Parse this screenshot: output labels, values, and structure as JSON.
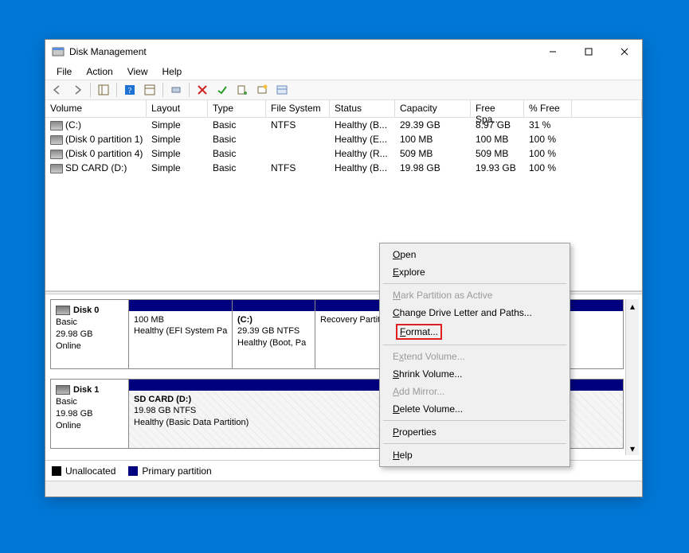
{
  "window": {
    "title": "Disk Management"
  },
  "menubar": [
    "File",
    "Action",
    "View",
    "Help"
  ],
  "columns": {
    "volume": "Volume",
    "layout": "Layout",
    "type": "Type",
    "fs": "File System",
    "status": "Status",
    "capacity": "Capacity",
    "free": "Free Spa...",
    "pct": "% Free"
  },
  "volumes": [
    {
      "name": "(C:)",
      "layout": "Simple",
      "type": "Basic",
      "fs": "NTFS",
      "status": "Healthy (B...",
      "capacity": "29.39 GB",
      "free": "8.97 GB",
      "pct": "31 %"
    },
    {
      "name": "(Disk 0 partition 1)",
      "layout": "Simple",
      "type": "Basic",
      "fs": "",
      "status": "Healthy (E...",
      "capacity": "100 MB",
      "free": "100 MB",
      "pct": "100 %"
    },
    {
      "name": "(Disk 0 partition 4)",
      "layout": "Simple",
      "type": "Basic",
      "fs": "",
      "status": "Healthy (R...",
      "capacity": "509 MB",
      "free": "509 MB",
      "pct": "100 %"
    },
    {
      "name": "SD CARD (D:)",
      "layout": "Simple",
      "type": "Basic",
      "fs": "NTFS",
      "status": "Healthy (B...",
      "capacity": "19.98 GB",
      "free": "19.93 GB",
      "pct": "100 %"
    }
  ],
  "disks": [
    {
      "name": "Disk 0",
      "type": "Basic",
      "size": "29.98 GB",
      "state": "Online",
      "parts": [
        {
          "title": "",
          "line2": "100 MB",
          "line3": "Healthy (EFI System Pa",
          "w": 130,
          "hatch": false
        },
        {
          "title": "(C:)",
          "line2": "29.39 GB NTFS",
          "line3": "Healthy (Boot, Pa",
          "w": 104,
          "hatch": false
        },
        {
          "title": "",
          "line2": "",
          "line3": "Recovery Partition)",
          "w": 0,
          "hatch": false
        }
      ]
    },
    {
      "name": "Disk 1",
      "type": "Basic",
      "size": "19.98 GB",
      "state": "Online",
      "parts": [
        {
          "title": "SD CARD  (D:)",
          "line2": "19.98 GB NTFS",
          "line3": "Healthy (Basic Data Partition)",
          "w": 0,
          "hatch": true
        }
      ]
    }
  ],
  "legend": {
    "unalloc": "Unallocated",
    "primary": "Primary partition"
  },
  "context_menu": [
    {
      "label": "Open",
      "u": "O",
      "disabled": false
    },
    {
      "label": "Explore",
      "u": "E",
      "disabled": false
    },
    {
      "sep": true
    },
    {
      "label": "Mark Partition as Active",
      "u": "M",
      "disabled": true
    },
    {
      "label": "Change Drive Letter and Paths...",
      "u": "C",
      "disabled": false
    },
    {
      "label": "Format...",
      "u": "F",
      "disabled": false,
      "highlight": true
    },
    {
      "sep": true
    },
    {
      "label": "Extend Volume...",
      "u": "x",
      "disabled": true
    },
    {
      "label": "Shrink Volume...",
      "u": "S",
      "disabled": false
    },
    {
      "label": "Add Mirror...",
      "u": "A",
      "disabled": true
    },
    {
      "label": "Delete Volume...",
      "u": "D",
      "disabled": false
    },
    {
      "sep": true
    },
    {
      "label": "Properties",
      "u": "P",
      "disabled": false
    },
    {
      "sep": true
    },
    {
      "label": "Help",
      "u": "H",
      "disabled": false
    }
  ]
}
